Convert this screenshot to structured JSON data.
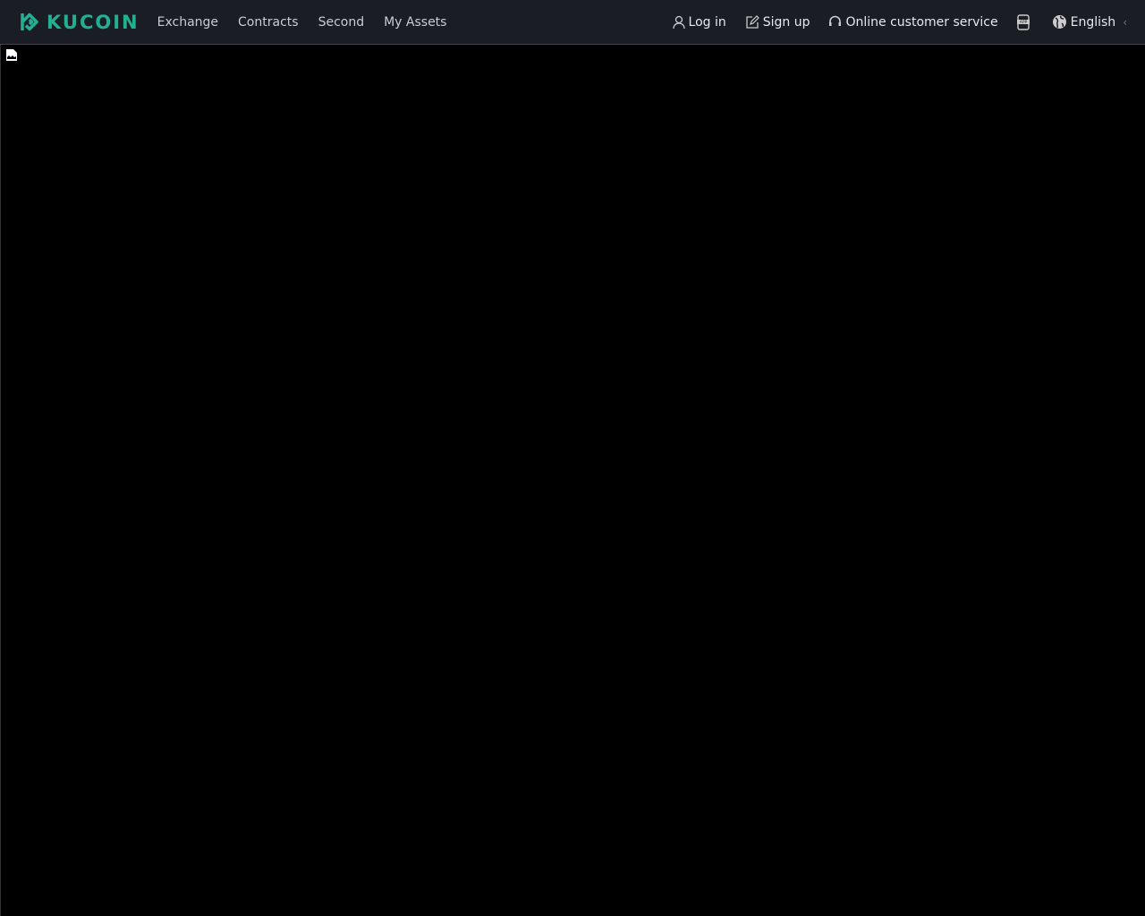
{
  "brand": {
    "name": "KUCOIN",
    "color": "#23af91"
  },
  "nav": {
    "links": [
      "Exchange",
      "Contracts",
      "Second",
      "My Assets"
    ]
  },
  "actions": {
    "login": "Log in",
    "signup": "Sign up",
    "service": "Online customer service",
    "app_icon": "APP",
    "language": "English"
  }
}
